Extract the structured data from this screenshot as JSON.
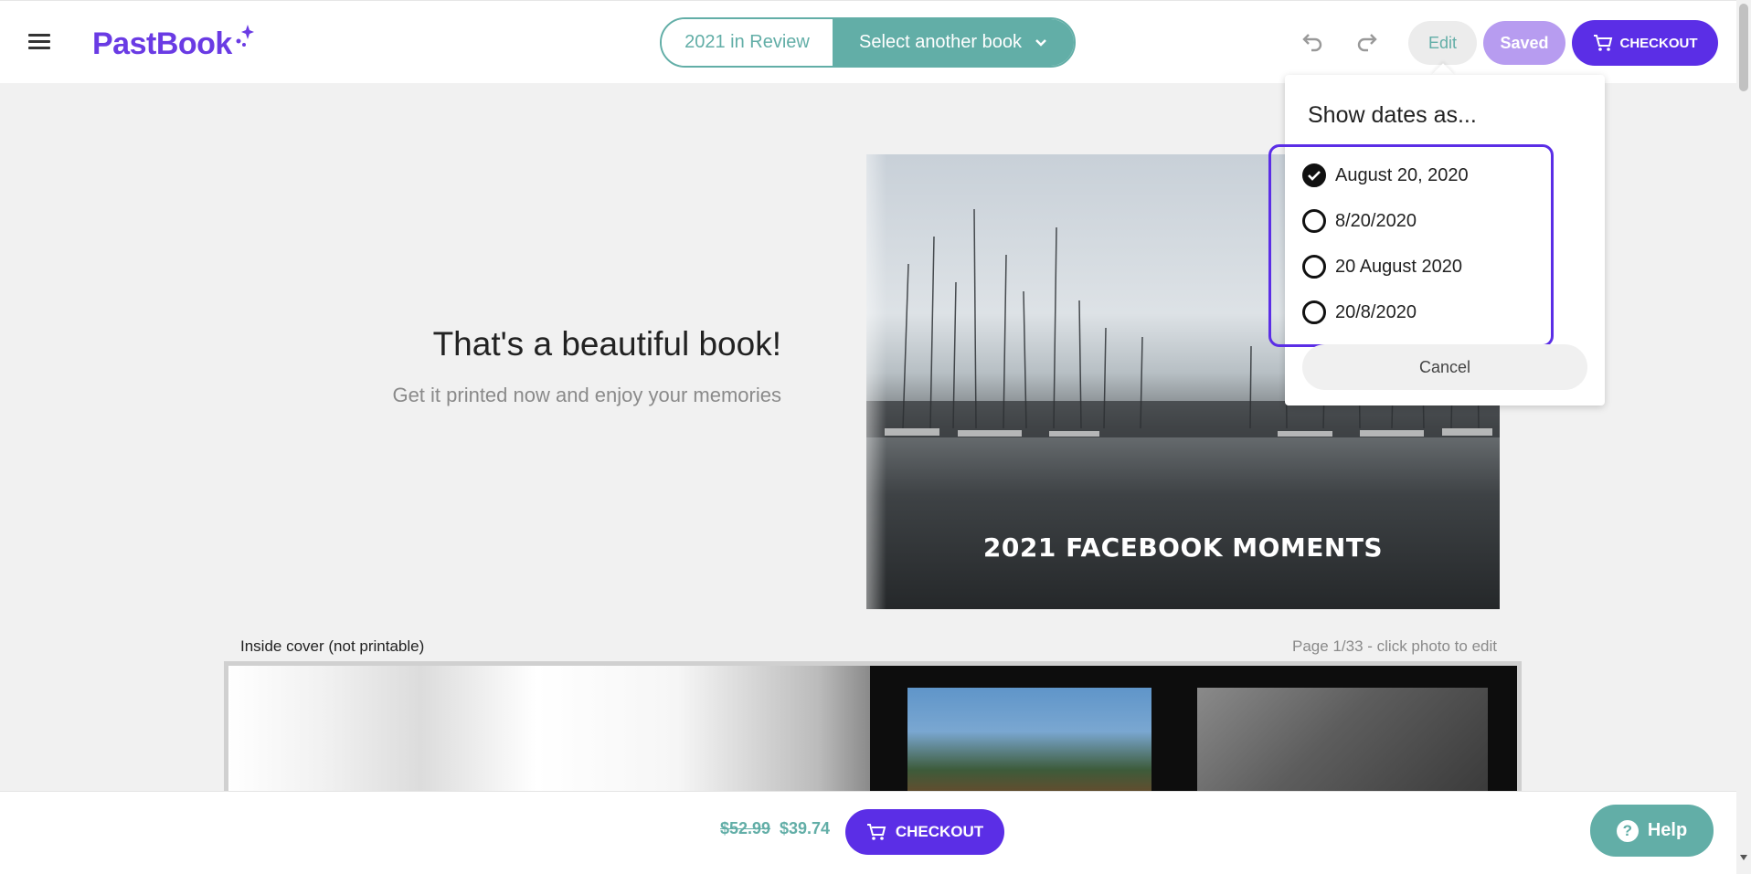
{
  "header": {
    "logo": "PastBook",
    "current_book": "2021 in Review",
    "select_book_label": "Select another book",
    "edit_label": "Edit",
    "saved_label": "Saved",
    "checkout_label": "CHECKOUT"
  },
  "hero": {
    "title": "That's a beautiful book!",
    "subtitle": "Get it printed now and enjoy your memories"
  },
  "cover": {
    "title": "2021 FACEBOOK MOMENTS"
  },
  "spread": {
    "inside_label": "Inside cover (not printable)",
    "page_info": "Page 1/33  - click photo to edit"
  },
  "date_popover": {
    "title": "Show dates as...",
    "options": [
      {
        "label": "August 20, 2020",
        "selected": true
      },
      {
        "label": "8/20/2020",
        "selected": false
      },
      {
        "label": "20 August 2020",
        "selected": false
      },
      {
        "label": "20/8/2020",
        "selected": false
      }
    ],
    "cancel_label": "Cancel"
  },
  "footer": {
    "old_price": "$52.99",
    "new_price": "$39.74",
    "checkout_label": "CHECKOUT",
    "help_label": "Help"
  },
  "colors": {
    "brand_purple": "#5b2ee6",
    "teal": "#62aea7",
    "saved_purple": "#b79cf0"
  }
}
